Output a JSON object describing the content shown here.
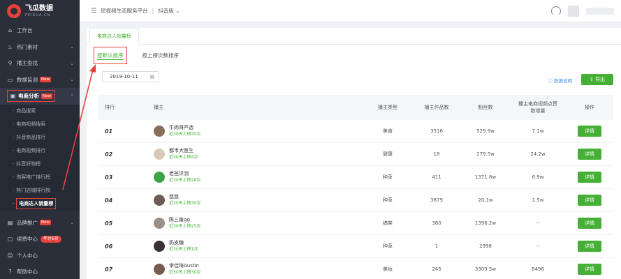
{
  "logo": {
    "name": "飞瓜数据",
    "sub": "FEIGUA.CN"
  },
  "sidebar": {
    "items": [
      {
        "label": "工作台",
        "icon": "home-icon"
      },
      {
        "label": "热门素材",
        "icon": "fire-icon"
      },
      {
        "label": "播主查找",
        "icon": "search-icon"
      },
      {
        "label": "数据监测",
        "icon": "monitor-icon",
        "badge": "New"
      },
      {
        "label": "电商分析",
        "icon": "cart-icon",
        "badge": "New"
      }
    ],
    "sub_items": [
      {
        "label": "商品搜索"
      },
      {
        "label": "电商视频搜索"
      },
      {
        "label": "抖音商品排行"
      },
      {
        "label": "电商视频排行"
      },
      {
        "label": "抖音好物榜"
      },
      {
        "label": "淘客推广排行榜"
      },
      {
        "label": "热门店铺排行榜"
      },
      {
        "label": "电商达人销量榜"
      }
    ],
    "bottom_items": [
      {
        "label": "品牌推广",
        "icon": "brand-icon",
        "badge": "New"
      },
      {
        "label": "续费中心",
        "icon": "renew-icon",
        "badge": "年付6折"
      },
      {
        "label": "个人中心",
        "icon": "user-icon"
      },
      {
        "label": "帮助中心",
        "icon": "help-icon"
      }
    ]
  },
  "header": {
    "crumb1": "短视频生态服务平台",
    "crumb2": "抖音版"
  },
  "main": {
    "tab": "电商达人销量榜",
    "subtab_active": "按默认排序",
    "subtab_other": "按上榜次数排序",
    "date": "2019-10-11",
    "explain": "数据说明",
    "export": "导出"
  },
  "table": {
    "headers": {
      "rank": "排行",
      "host": "播主",
      "type": "播主类型",
      "works": "播主作品数",
      "fans": "粉丝数",
      "avg": "播主电商视频点赞数增量",
      "op": "操作"
    },
    "rows": [
      {
        "rank": "01",
        "name": "牛肉哥严选",
        "sub": "近30天上榜30次",
        "type": "美食",
        "works": "3516",
        "fans": "529.9w",
        "avg": "7.1w",
        "op": "详情",
        "avatar_color": "#8a6d5a"
      },
      {
        "rank": "02",
        "name": "都市大医生",
        "sub": "近30天上榜4次",
        "type": "健康",
        "works": "18",
        "fans": "279.5w",
        "avg": "24.2w",
        "op": "详情",
        "avatar_color": "#d7c9b6"
      },
      {
        "rank": "03",
        "name": "老爸评测",
        "sub": "近30天上榜28次",
        "type": "种草",
        "works": "411",
        "fans": "1371.8w",
        "avg": "6.9w",
        "op": "详情",
        "avatar_color": "#3aa547"
      },
      {
        "rank": "04",
        "name": "悠悠",
        "sub": "近30天上榜30次",
        "type": "种草",
        "works": "3879",
        "fans": "20.1w",
        "avg": "1.5w",
        "op": "详情",
        "avatar_color": "#6b5d55"
      },
      {
        "rank": "05",
        "name": "陈三废gg",
        "sub": "近30天上榜25次",
        "type": "搞笑",
        "works": "380",
        "fans": "1396.2w",
        "avg": "--",
        "op": "详情",
        "avatar_color": "#9a8f86"
      },
      {
        "rank": "06",
        "name": "奶皮糖",
        "sub": "近30天上榜1次",
        "type": "种草",
        "works": "1",
        "fans": "2998",
        "avg": "--",
        "op": "详情",
        "avatar_color": "#3b3031"
      },
      {
        "rank": "07",
        "name": "李佳琦Austin",
        "sub": "近30天上榜30次",
        "type": "美妆",
        "works": "245",
        "fans": "3309.5w",
        "avg": "8496",
        "op": "详情",
        "avatar_color": "#7a5b52"
      }
    ]
  },
  "colors": {
    "accent_green": "#45b035",
    "annotation_red": "#e8413c",
    "sidebar_bg": "#2b2f3a"
  }
}
